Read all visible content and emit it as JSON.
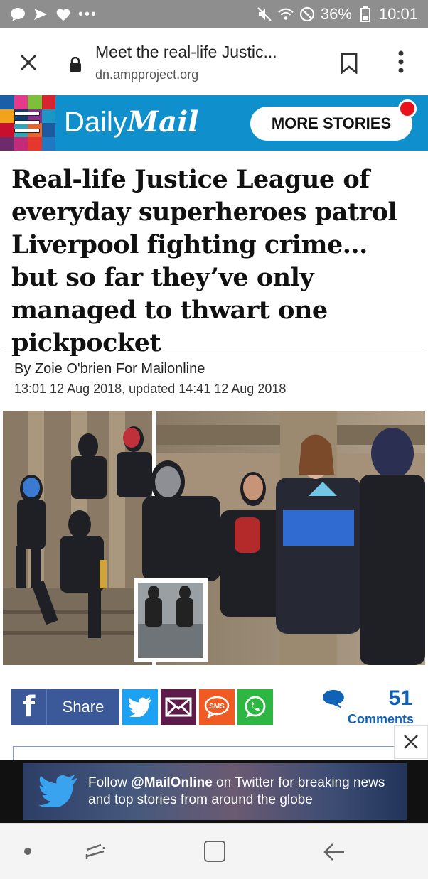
{
  "status_bar": {
    "battery": "36%",
    "time": "10:01",
    "icons": [
      "chat-bubble-icon",
      "missed-call-icon",
      "heart-icon",
      "more-dots-icon",
      "mute-icon",
      "wifi-icon",
      "dnd-icon",
      "battery-icon"
    ]
  },
  "browser": {
    "title": "Meet the real-life Justic...",
    "url": "dn.ampproject.org"
  },
  "header": {
    "logo_daily": "Daily",
    "logo_mail": "Mail",
    "more_stories": "MORE STORIES",
    "brand_color": "#0f8fcc"
  },
  "article": {
    "headline": "Real-life Justice League of everyday superheroes patrol Liverpool fighting crime... but so far they’ve only managed to thwart one pickpocket",
    "byline": "By Zoie O'brien For Mailonline",
    "dateline": "13:01 12 Aug 2018, updated 14:41 12 Aug 2018"
  },
  "share": {
    "facebook_label": "Share",
    "comment_count": "51",
    "comments_label": "Comments",
    "sms_label": "SMS"
  },
  "banner": {
    "text_prefix": "Follow ",
    "handle": "@MailOnline",
    "text_suffix": " on Twitter for breaking news and top stories from around the globe"
  }
}
